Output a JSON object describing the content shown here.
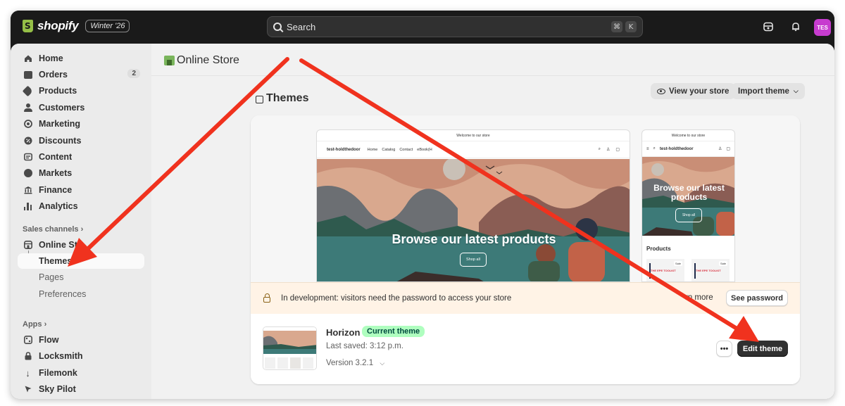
{
  "colors": {
    "accent_red": "#f0321e",
    "badge_green": "#affebf",
    "brand_green": "#95bf47",
    "avatar": "#c73ccf"
  },
  "topbar": {
    "brand": "shopify",
    "edition": "Winter '26",
    "search": {
      "placeholder": "Search",
      "shortcut_1": "⌘",
      "shortcut_2": "K"
    },
    "avatar_initials": "TES",
    "icons": [
      "store-switch-icon",
      "bell-icon"
    ]
  },
  "sidebar": {
    "items": [
      {
        "label": "Home",
        "icon": "home-icon"
      },
      {
        "label": "Orders",
        "icon": "inbox-icon",
        "badge": "2"
      },
      {
        "label": "Products",
        "icon": "tag-icon"
      },
      {
        "label": "Customers",
        "icon": "person-icon"
      },
      {
        "label": "Marketing",
        "icon": "target-icon"
      },
      {
        "label": "Discounts",
        "icon": "discount-icon"
      },
      {
        "label": "Content",
        "icon": "image-icon"
      },
      {
        "label": "Markets",
        "icon": "globe-icon"
      },
      {
        "label": "Finance",
        "icon": "bank-icon"
      },
      {
        "label": "Analytics",
        "icon": "chart-icon"
      }
    ],
    "sales_channels_label": "Sales channels",
    "online_store": {
      "label": "Online Sto",
      "icon": "store-icon"
    },
    "sub_items": [
      "Themes",
      "Pages",
      "Preferences"
    ],
    "apps_label": "Apps",
    "apps": [
      {
        "label": "Flow",
        "icon": "flow-icon"
      },
      {
        "label": "Locksmith",
        "icon": "lock-icon"
      },
      {
        "label": "Filemonk",
        "icon": "arrow-down-icon"
      },
      {
        "label": "Sky Pilot",
        "icon": "pointer-icon"
      }
    ]
  },
  "header": {
    "title": "Online Store"
  },
  "themes": {
    "title": "Themes",
    "view_store": "View your store",
    "import_theme": "Import theme",
    "preview": {
      "announcement": "Welcome to our store",
      "store_name": "test-holdthedoor",
      "nav": [
        "Home",
        "Catalog",
        "Contact",
        "eBook(H"
      ],
      "hero_title": "Browse our latest products",
      "hero_button": "Shop all",
      "mobile_hero_title": "Browse our latest products",
      "products_heading": "Products",
      "product_badge": "Sale",
      "product_title": "THE EPE TOOLKIT"
    },
    "banner": {
      "text": "In development: visitors need the password to access your store",
      "learn_more": "rn more",
      "see_password": "See password"
    },
    "theme": {
      "name": "Horizon",
      "badge": "Current theme",
      "last_saved": "Last saved: 3:12 p.m.",
      "version": "Version 3.2.1",
      "more": "•••",
      "edit": "Edit theme"
    }
  }
}
